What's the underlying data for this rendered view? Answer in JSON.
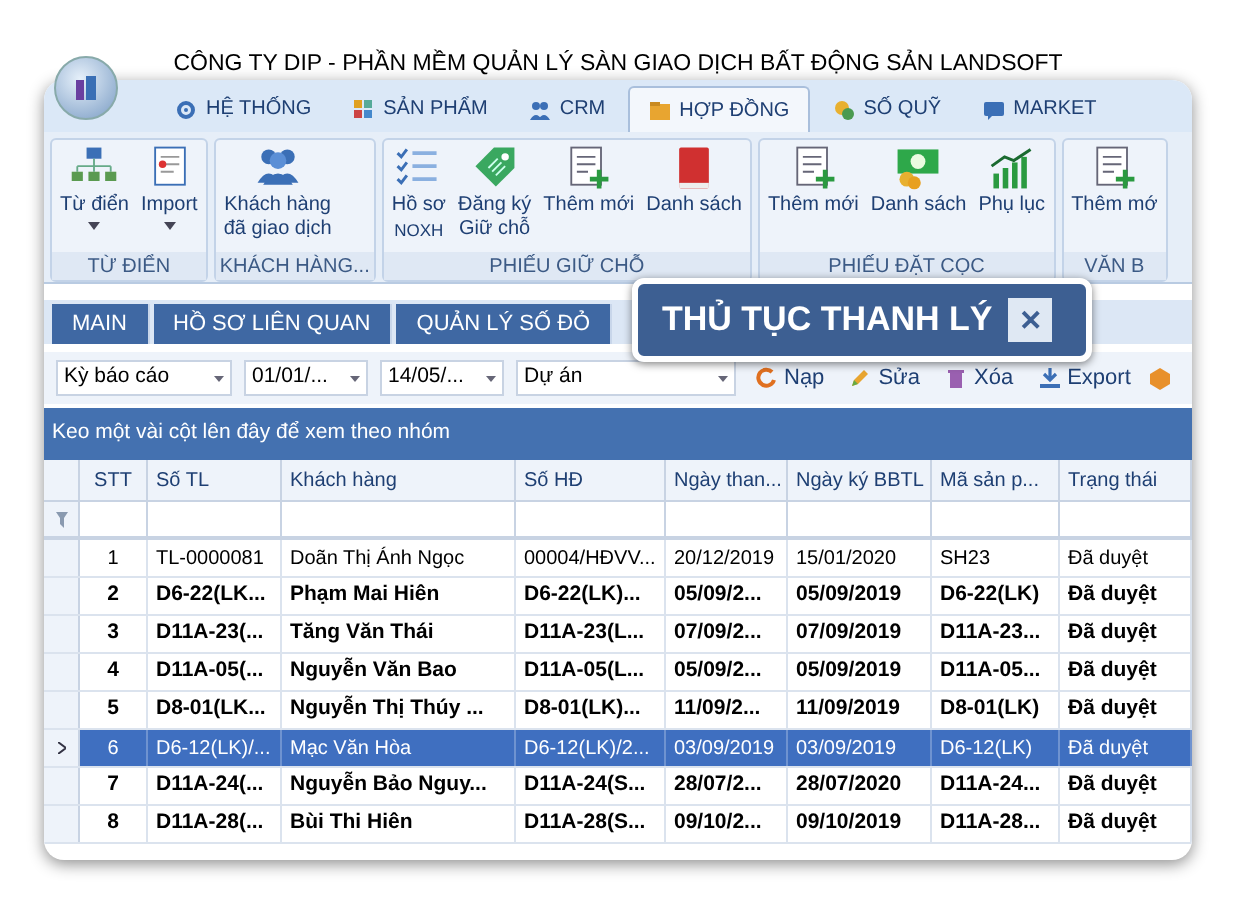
{
  "title": "CÔNG TY DIP - PHẦN MỀM QUẢN LÝ SÀN GIAO DỊCH BẤT ĐỘNG SẢN LANDSOFT",
  "ribbon_tabs": [
    {
      "label": "HỆ THỐNG",
      "selected": false
    },
    {
      "label": "SẢN PHẨM",
      "selected": false
    },
    {
      "label": "CRM",
      "selected": false
    },
    {
      "label": "HỢP ĐỒNG",
      "selected": true
    },
    {
      "label": "SỐ QUỸ",
      "selected": false
    },
    {
      "label": "MARKET",
      "selected": false
    }
  ],
  "ribbon_groups": [
    {
      "label": "TỪ ĐIỂN",
      "buttons": [
        {
          "lines": [
            "Từ điển"
          ],
          "dropdown": true
        },
        {
          "lines": [
            "Import"
          ],
          "dropdown": true
        }
      ]
    },
    {
      "label": "KHÁCH HÀNG...",
      "buttons": [
        {
          "lines": [
            "Khách hàng",
            "đã giao dịch"
          ],
          "dropdown": false
        }
      ]
    },
    {
      "label": "PHIẾU GIỮ CHỖ",
      "buttons": [
        {
          "lines": [
            "Hồ sơ",
            "NOXH"
          ],
          "dropdown": false
        },
        {
          "lines": [
            "Đăng ký",
            "Giữ chỗ"
          ],
          "dropdown": false
        },
        {
          "lines": [
            "Thêm mới"
          ],
          "dropdown": false
        },
        {
          "lines": [
            "Danh sách"
          ],
          "dropdown": false
        }
      ]
    },
    {
      "label": "PHIẾU ĐẶT CỌC",
      "buttons": [
        {
          "lines": [
            "Thêm mới"
          ],
          "dropdown": false
        },
        {
          "lines": [
            "Danh sách"
          ],
          "dropdown": false
        },
        {
          "lines": [
            "Phụ lục"
          ],
          "dropdown": false
        }
      ]
    },
    {
      "label": "VĂN B",
      "buttons": [
        {
          "lines": [
            "Thêm mớ"
          ],
          "dropdown": false
        }
      ]
    }
  ],
  "doc_tabs": [
    {
      "label": "MAIN"
    },
    {
      "label": "HỒ SƠ LIÊN QUAN"
    },
    {
      "label": "QUẢN LÝ SỐ ĐỎ"
    }
  ],
  "callout": {
    "title": "THỦ TỤC THANH LÝ",
    "close": "✕"
  },
  "filters": [
    {
      "value": "Kỳ báo cáo"
    },
    {
      "value": "01/01/..."
    },
    {
      "value": "14/05/..."
    },
    {
      "value": "Dự án"
    }
  ],
  "actions": [
    {
      "label": "Nạp"
    },
    {
      "label": "Sửa"
    },
    {
      "label": "Xóa"
    },
    {
      "label": "Export"
    }
  ],
  "group_panel": "Keo một vài cột lên đây để xem theo nhóm",
  "table": {
    "columns": [
      "STT",
      "Số TL",
      "Khách hàng",
      "Số HĐ",
      "Ngày than...",
      "Ngày ký BBTL",
      "Mã sản p...",
      "Trạng thái"
    ],
    "rows": [
      {
        "selected": false,
        "bold": false,
        "cells": [
          "1",
          "TL-0000081",
          "Doãn Thị Ánh Ngọc",
          "00004/HĐVV...",
          "20/12/2019",
          "15/01/2020",
          "SH23",
          "Đã duyệt"
        ]
      },
      {
        "selected": false,
        "bold": true,
        "cells": [
          "2",
          "D6-22(LK...",
          "Phạm Mai Hiên",
          "D6-22(LK)...",
          "05/09/2...",
          "05/09/2019",
          "D6-22(LK)",
          "Đã duyệt"
        ]
      },
      {
        "selected": false,
        "bold": true,
        "cells": [
          "3",
          "D11A-23(...",
          "Tăng Văn Thái",
          "D11A-23(L...",
          "07/09/2...",
          "07/09/2019",
          "D11A-23...",
          "Đã duyệt"
        ]
      },
      {
        "selected": false,
        "bold": true,
        "cells": [
          "4",
          "D11A-05(...",
          "Nguyễn Văn Bao",
          "D11A-05(L...",
          "05/09/2...",
          "05/09/2019",
          "D11A-05...",
          "Đã duyệt"
        ]
      },
      {
        "selected": false,
        "bold": true,
        "cells": [
          "5",
          "D8-01(LK...",
          "Nguyễn Thị Thúy ...",
          "D8-01(LK)...",
          "11/09/2...",
          "11/09/2019",
          "D8-01(LK)",
          "Đã duyệt"
        ]
      },
      {
        "selected": true,
        "bold": false,
        "cells": [
          "6",
          "D6-12(LK)/...",
          "Mạc Văn Hòa",
          "D6-12(LK)/2...",
          "03/09/2019",
          "03/09/2019",
          "D6-12(LK)",
          "Đã duyệt"
        ]
      },
      {
        "selected": false,
        "bold": true,
        "cells": [
          "7",
          "D11A-24(...",
          "Nguyễn Bảo Nguy...",
          "D11A-24(S...",
          "28/07/2...",
          "28/07/2020",
          "D11A-24...",
          "Đã duyệt"
        ]
      },
      {
        "selected": false,
        "bold": true,
        "cells": [
          "8",
          "D11A-28(...",
          "Bùi Thi Hiên",
          "D11A-28(S...",
          "09/10/2...",
          "09/10/2019",
          "D11A-28...",
          "Đã duyệt"
        ]
      }
    ]
  }
}
